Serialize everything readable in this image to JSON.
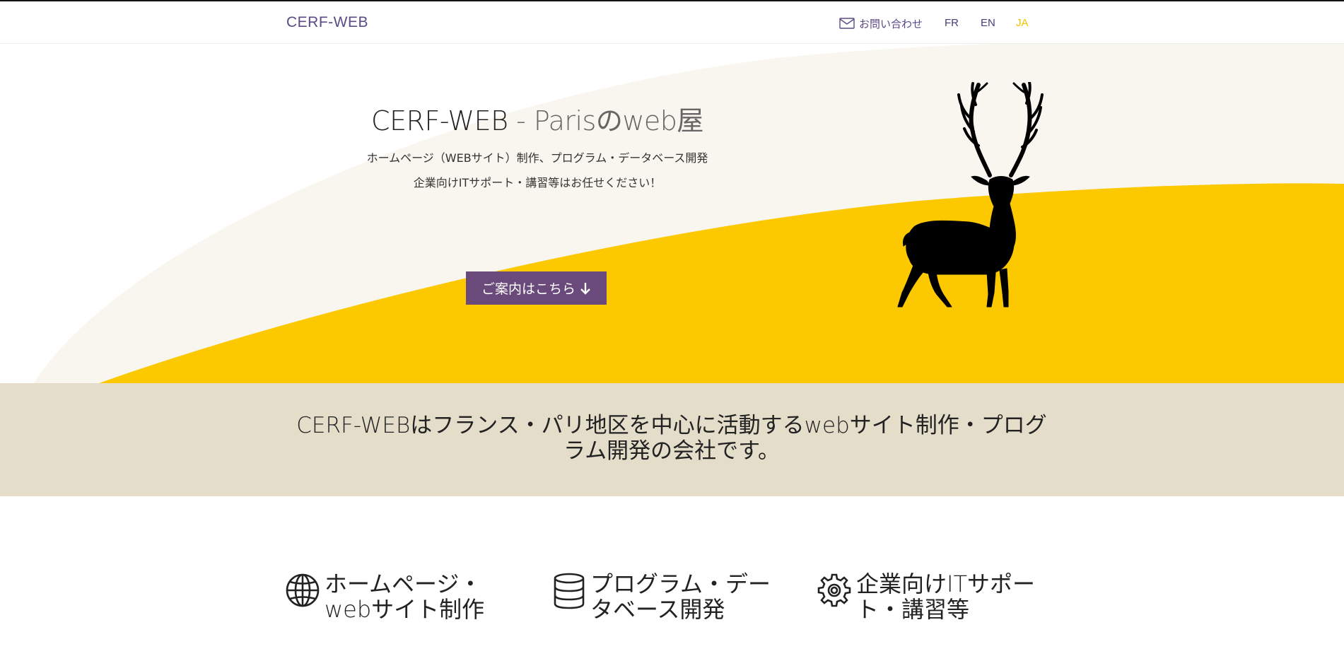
{
  "header": {
    "logo": "CERF-WEB",
    "contact_label": "お問い合わせ",
    "languages": [
      "FR",
      "EN",
      "JA"
    ],
    "active_language": "JA"
  },
  "hero": {
    "title_main": "CERF-WEB",
    "title_rest": " - Parisのweb屋",
    "subtitle_line1": "ホームページ（WEBサイト）制作、プログラム・データベース開発",
    "subtitle_line2": "企業向けITサポート・講習等はお任せください！",
    "cta_label": "ご案内はこちら"
  },
  "band": {
    "text": "CERF-WEBはフランス・パリ地区を中心に活動するwebサイト制作・プログラム開発の会社です。"
  },
  "features": [
    {
      "icon": "globe-icon",
      "label": "ホームページ・webサイト制作"
    },
    {
      "icon": "database-icon",
      "label": "プログラム・データベース開発"
    },
    {
      "icon": "gear-icon",
      "label": "企業向けITサポート・講習等"
    }
  ],
  "colors": {
    "accent_purple": "#6a4a7a",
    "logo_purple": "#5a4a86",
    "yellow": "#fcc800",
    "cream": "#f8f6ee",
    "band": "#e3ddca"
  }
}
